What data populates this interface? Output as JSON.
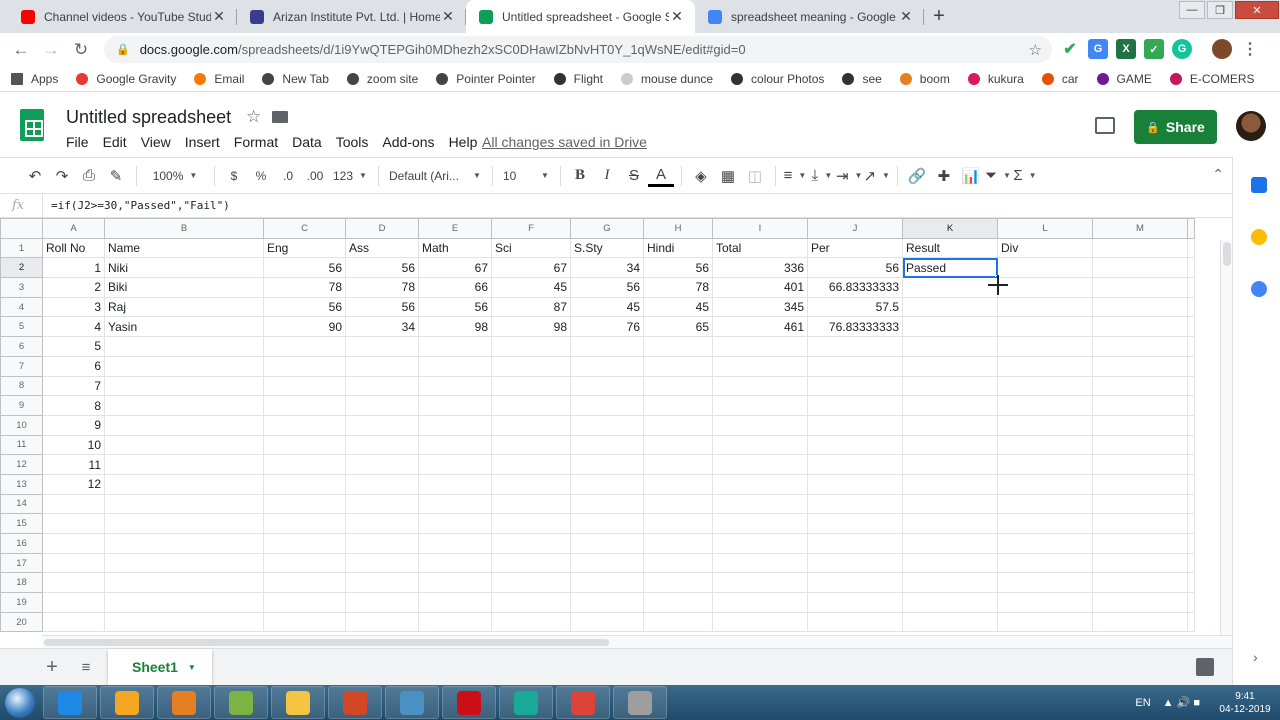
{
  "browser": {
    "tabs": [
      {
        "title": "Channel videos - YouTube Studio",
        "icon": "youtube-icon",
        "color": "#ff0000",
        "active": false
      },
      {
        "title": "Arizan Institute Pvt. Ltd. | Home ::",
        "icon": "arizan-icon",
        "color": "#3b3b8f",
        "active": false
      },
      {
        "title": "Untitled spreadsheet - Google Sheets",
        "icon": "sheets-icon",
        "color": "#0f9d58",
        "active": true
      },
      {
        "title": "spreadsheet meaning - Google Search",
        "icon": "google-icon",
        "color": "#4285f4",
        "active": false
      }
    ],
    "url_domain": "docs.google.com",
    "url_path": "/spreadsheets/d/1i9YwQTEPGih0MDhezh2xSC0DHawIZbNvHT0Y_1qWsNE/edit#gid=0",
    "bookmarks": [
      {
        "label": "Apps",
        "icon": "apps-icon"
      },
      {
        "label": "Google Gravity",
        "icon": "gravity-icon"
      },
      {
        "label": "Email",
        "icon": "email-icon"
      },
      {
        "label": "New Tab",
        "icon": "globe-icon"
      },
      {
        "label": "zoom site",
        "icon": "globe-icon"
      },
      {
        "label": "Pointer Pointer",
        "icon": "globe-icon"
      },
      {
        "label": "Flight",
        "icon": "flight-icon"
      },
      {
        "label": "mouse dunce",
        "icon": "page-icon"
      },
      {
        "label": "colour Photos",
        "icon": "photo-icon"
      },
      {
        "label": "see",
        "icon": "see-icon"
      },
      {
        "label": "boom",
        "icon": "boom-icon"
      },
      {
        "label": "kukura",
        "icon": "kukura-icon"
      },
      {
        "label": "car",
        "icon": "car-icon"
      },
      {
        "label": "GAME",
        "icon": "game-icon"
      },
      {
        "label": "E-COMERS",
        "icon": "ecom-icon"
      }
    ]
  },
  "doc": {
    "title": "Untitled spreadsheet",
    "menus": [
      "File",
      "Edit",
      "View",
      "Insert",
      "Format",
      "Data",
      "Tools",
      "Add-ons",
      "Help"
    ],
    "save_status": "All changes saved in Drive",
    "share_label": "Share"
  },
  "toolbar": {
    "zoom": "100%",
    "currency": "$",
    "percent": "%",
    "dec_less": ".0",
    "dec_more": ".00",
    "format_more": "123",
    "font": "Default (Ari...",
    "font_size": "10"
  },
  "formula_bar": {
    "fx": "fx",
    "formula": "=if(J2>=30,\"Passed\",\"Fail\")"
  },
  "grid": {
    "columns": [
      "A",
      "B",
      "C",
      "D",
      "E",
      "F",
      "G",
      "H",
      "I",
      "J",
      "K",
      "L",
      "M"
    ],
    "selected_column": "K",
    "selected_row": "2",
    "rows": [
      {
        "n": "1",
        "cells": [
          "Roll No",
          "Name",
          "Eng",
          "Ass",
          "Math",
          "Sci",
          "S.Sty",
          "Hindi",
          "Total",
          "Per",
          "Result",
          "Div",
          ""
        ]
      },
      {
        "n": "2",
        "cells": [
          "1",
          "Niki",
          "56",
          "56",
          "67",
          "67",
          "34",
          "56",
          "336",
          "56",
          "Passed",
          "",
          ""
        ]
      },
      {
        "n": "3",
        "cells": [
          "2",
          "Biki",
          "78",
          "78",
          "66",
          "45",
          "56",
          "78",
          "401",
          "66.83333333",
          "",
          "",
          ""
        ]
      },
      {
        "n": "4",
        "cells": [
          "3",
          "Raj",
          "56",
          "56",
          "56",
          "87",
          "45",
          "45",
          "345",
          "57.5",
          "",
          "",
          ""
        ]
      },
      {
        "n": "5",
        "cells": [
          "4",
          "Yasin",
          "90",
          "34",
          "98",
          "98",
          "76",
          "65",
          "461",
          "76.83333333",
          "",
          "",
          ""
        ]
      },
      {
        "n": "6",
        "cells": [
          "5",
          "",
          "",
          "",
          "",
          "",
          "",
          "",
          "",
          "",
          "",
          "",
          ""
        ]
      },
      {
        "n": "7",
        "cells": [
          "6",
          "",
          "",
          "",
          "",
          "",
          "",
          "",
          "",
          "",
          "",
          "",
          ""
        ]
      },
      {
        "n": "8",
        "cells": [
          "7",
          "",
          "",
          "",
          "",
          "",
          "",
          "",
          "",
          "",
          "",
          "",
          ""
        ]
      },
      {
        "n": "9",
        "cells": [
          "8",
          "",
          "",
          "",
          "",
          "",
          "",
          "",
          "",
          "",
          "",
          "",
          ""
        ]
      },
      {
        "n": "10",
        "cells": [
          "9",
          "",
          "",
          "",
          "",
          "",
          "",
          "",
          "",
          "",
          "",
          "",
          ""
        ]
      },
      {
        "n": "11",
        "cells": [
          "10",
          "",
          "",
          "",
          "",
          "",
          "",
          "",
          "",
          "",
          "",
          "",
          ""
        ]
      },
      {
        "n": "12",
        "cells": [
          "11",
          "",
          "",
          "",
          "",
          "",
          "",
          "",
          "",
          "",
          "",
          "",
          ""
        ]
      },
      {
        "n": "13",
        "cells": [
          "12",
          "",
          "",
          "",
          "",
          "",
          "",
          "",
          "",
          "",
          "",
          "",
          ""
        ]
      },
      {
        "n": "14",
        "cells": [
          "",
          "",
          "",
          "",
          "",
          "",
          "",
          "",
          "",
          "",
          "",
          "",
          ""
        ]
      },
      {
        "n": "15",
        "cells": [
          "",
          "",
          "",
          "",
          "",
          "",
          "",
          "",
          "",
          "",
          "",
          "",
          ""
        ]
      },
      {
        "n": "16",
        "cells": [
          "",
          "",
          "",
          "",
          "",
          "",
          "",
          "",
          "",
          "",
          "",
          "",
          ""
        ]
      },
      {
        "n": "17",
        "cells": [
          "",
          "",
          "",
          "",
          "",
          "",
          "",
          "",
          "",
          "",
          "",
          "",
          ""
        ]
      },
      {
        "n": "18",
        "cells": [
          "",
          "",
          "",
          "",
          "",
          "",
          "",
          "",
          "",
          "",
          "",
          "",
          ""
        ]
      },
      {
        "n": "19",
        "cells": [
          "",
          "",
          "",
          "",
          "",
          "",
          "",
          "",
          "",
          "",
          "",
          "",
          ""
        ]
      },
      {
        "n": "20",
        "cells": [
          "",
          "",
          "",
          "",
          "",
          "",
          "",
          "",
          "",
          "",
          "",
          "",
          ""
        ]
      }
    ]
  },
  "sheets": [
    {
      "label": "Sheet1"
    }
  ],
  "taskbar": {
    "apps": [
      {
        "name": "ie-icon",
        "color": "#1e88e5"
      },
      {
        "name": "chrome-canary-icon",
        "color": "#f5a623"
      },
      {
        "name": "media-player-icon",
        "color": "#e67e22"
      },
      {
        "name": "editor-icon",
        "color": "#7cb342"
      },
      {
        "name": "folder-icon",
        "color": "#f4c542"
      },
      {
        "name": "powerpoint-icon",
        "color": "#d24726"
      },
      {
        "name": "photos-icon",
        "color": "#4a90c2"
      },
      {
        "name": "opera-icon",
        "color": "#cc0f16"
      },
      {
        "name": "tiktok-icon",
        "color": "#18a999"
      },
      {
        "name": "chrome-icon",
        "color": "#db4437"
      },
      {
        "name": "calculator-icon",
        "color": "#9e9e9e"
      }
    ],
    "lang": "EN",
    "time": "9:41",
    "date": "04-12-2019"
  },
  "colors": {
    "brand_green": "#0f9d58",
    "share_green": "#188038",
    "selection_blue": "#1a73e8"
  }
}
